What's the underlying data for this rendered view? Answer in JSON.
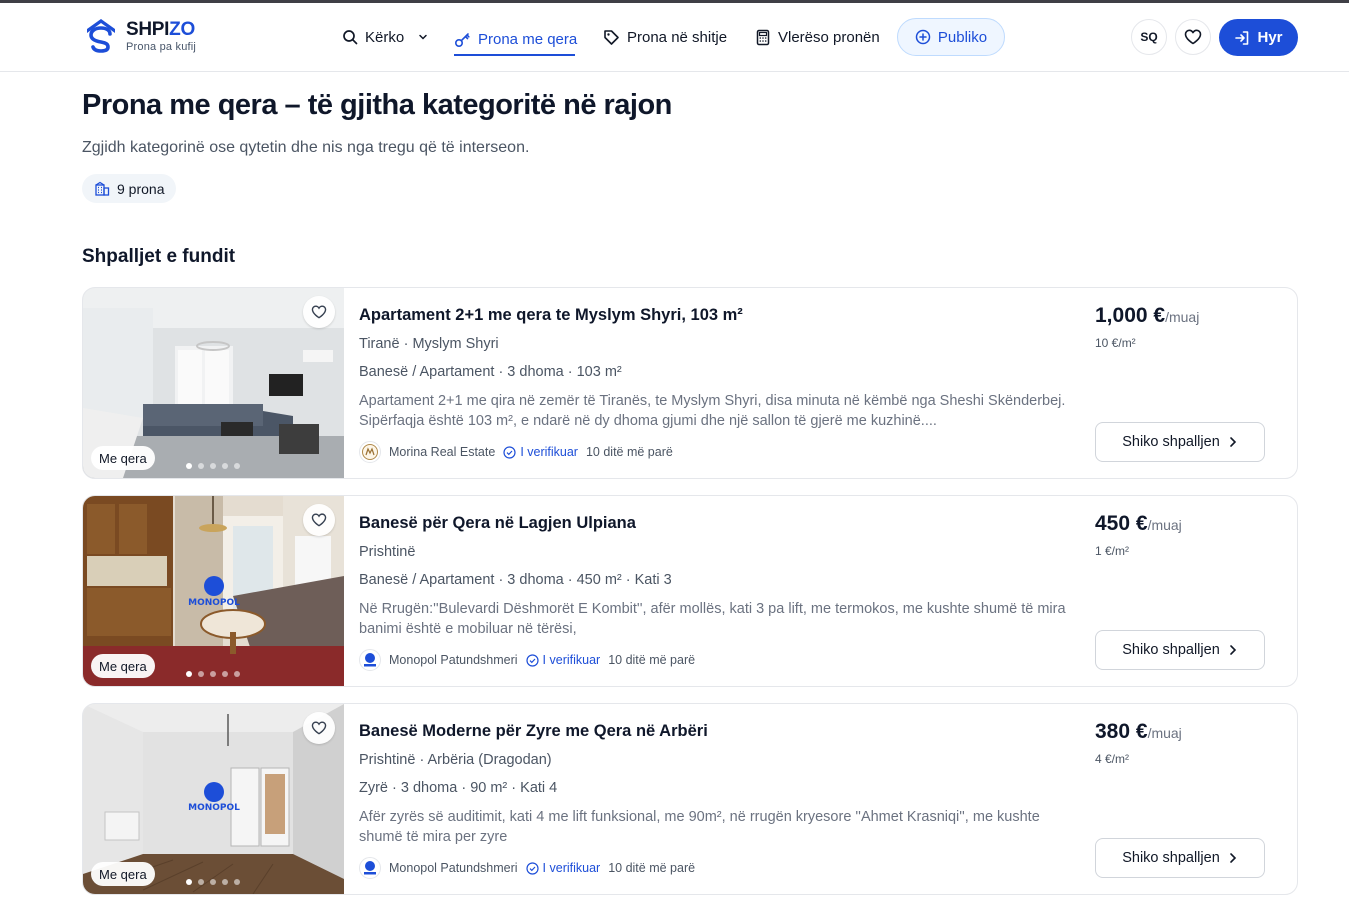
{
  "brand": {
    "name_main": "SHPI",
    "name_accent": "ZO",
    "tagline": "Prona pa kufij",
    "accent_color": "#1d4ed8"
  },
  "nav": {
    "search": {
      "label": "Kërko",
      "icon": "search-icon"
    },
    "rent": {
      "label": "Prona me qera",
      "icon": "key-icon"
    },
    "sale": {
      "label": "Prona në shitje",
      "icon": "tag-icon"
    },
    "valuate": {
      "label": "Vlerëso pronën",
      "icon": "calculator-icon"
    },
    "publish": {
      "label": "Publiko",
      "icon": "plus-circle-icon"
    }
  },
  "header_actions": {
    "language": "SQ",
    "favorites_icon": "heart-icon",
    "login": "Hyr",
    "login_icon": "login-icon"
  },
  "page": {
    "title": "Prona me qera – të gjitha kategoritë në rajon",
    "subtitle": "Zgjidh kategorinë ose qytetin dhe nis nga tregu që të interseon.",
    "count_label": "9 prona",
    "section_title": "Shpalljet e fundit"
  },
  "listings": [
    {
      "title": "Apartament 2+1 me qera te Myslym Shyri, 103 m²",
      "location": "Tiranë · Myslym Shyri",
      "meta": "Banesë / Apartament · 3 dhoma · 103 m²",
      "description": "Apartament 2+1 me qira në zemër të Tiranës, te Myslym Shyri, disa minuta në këmbë nga Sheshi Skënderbej. Sipërfaqja është 103 m², e ndarë në dy dhoma gjumi dhe një sallon të gjerë me kuzhinë....",
      "agent": "Morina Real Estate",
      "verified": "I verifikuar",
      "age": "10 ditë më parë",
      "price": "1,000 €",
      "price_unit": "/muaj",
      "price_m2": "10 €/m²",
      "badge": "Me qera",
      "cta": "Shiko shpalljen"
    },
    {
      "title": "Banesë për Qera në Lagjen Ulpiana",
      "location": "Prishtinë",
      "meta": "Banesë / Apartament · 3 dhoma · 450 m² · Kati 3",
      "description": "Në Rrugën:''Bulevardi Dëshmorët E Kombit'', afër mollës, kati 3 pa lift, me termokos, me kushte shumë të mira banimi është e mobiluar në tërësi,",
      "agent": "Monopol Patundshmeri",
      "verified": "I verifikuar",
      "age": "10 ditë më parë",
      "price": "450 €",
      "price_unit": "/muaj",
      "price_m2": "1 €/m²",
      "badge": "Me qera",
      "cta": "Shiko shpalljen",
      "watermark": "MONOPOL"
    },
    {
      "title": "Banesë Moderne për Zyre me Qera në Arbëri",
      "location": "Prishtinë · Arbëria (Dragodan)",
      "meta": "Zyrë · 3 dhoma · 90 m² · Kati 4",
      "description": "Afër zyrës së auditimit, kati 4 me lift funksional, me 90m², në rrugën kryesore ''Ahmet Krasniqi'', me kushte shumë të mira per zyre",
      "agent": "Monopol Patundshmeri",
      "verified": "I verifikuar",
      "age": "10 ditë më parë",
      "price": "380 €",
      "price_unit": "/muaj",
      "price_m2": "4 €/m²",
      "badge": "Me qera",
      "cta": "Shiko shpalljen",
      "watermark": "MONOPOL"
    }
  ]
}
